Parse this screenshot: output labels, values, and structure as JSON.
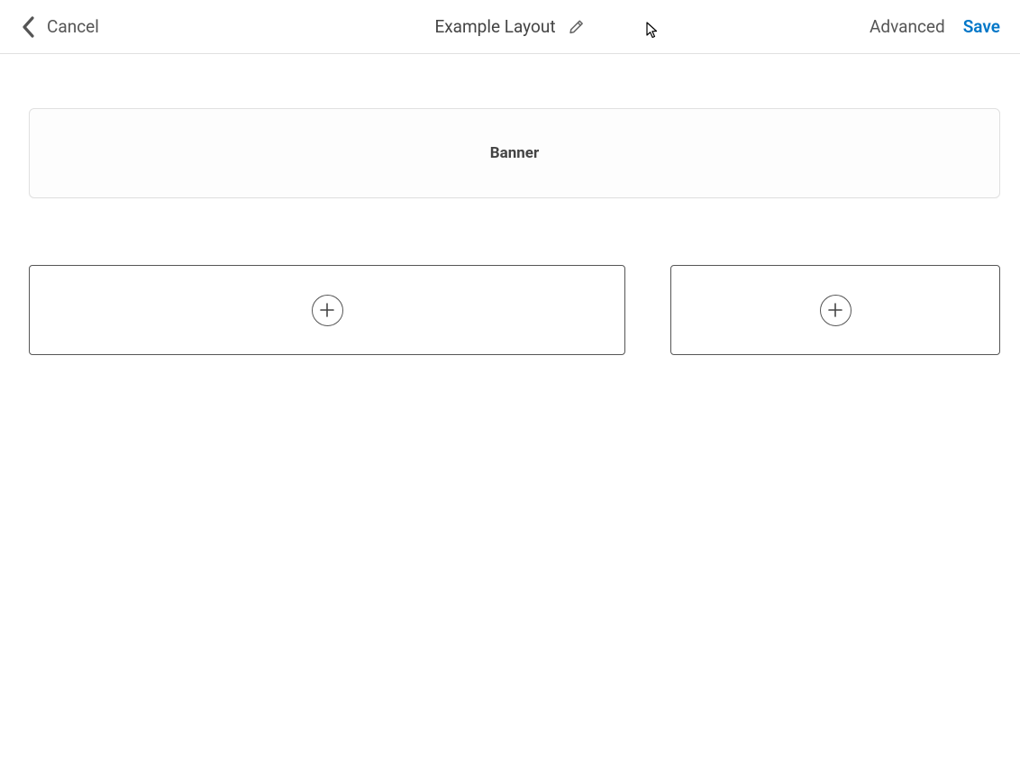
{
  "header": {
    "cancel_label": "Cancel",
    "title": "Example Layout",
    "advanced_label": "Advanced",
    "save_label": "Save"
  },
  "main": {
    "banner_label": "Banner"
  }
}
